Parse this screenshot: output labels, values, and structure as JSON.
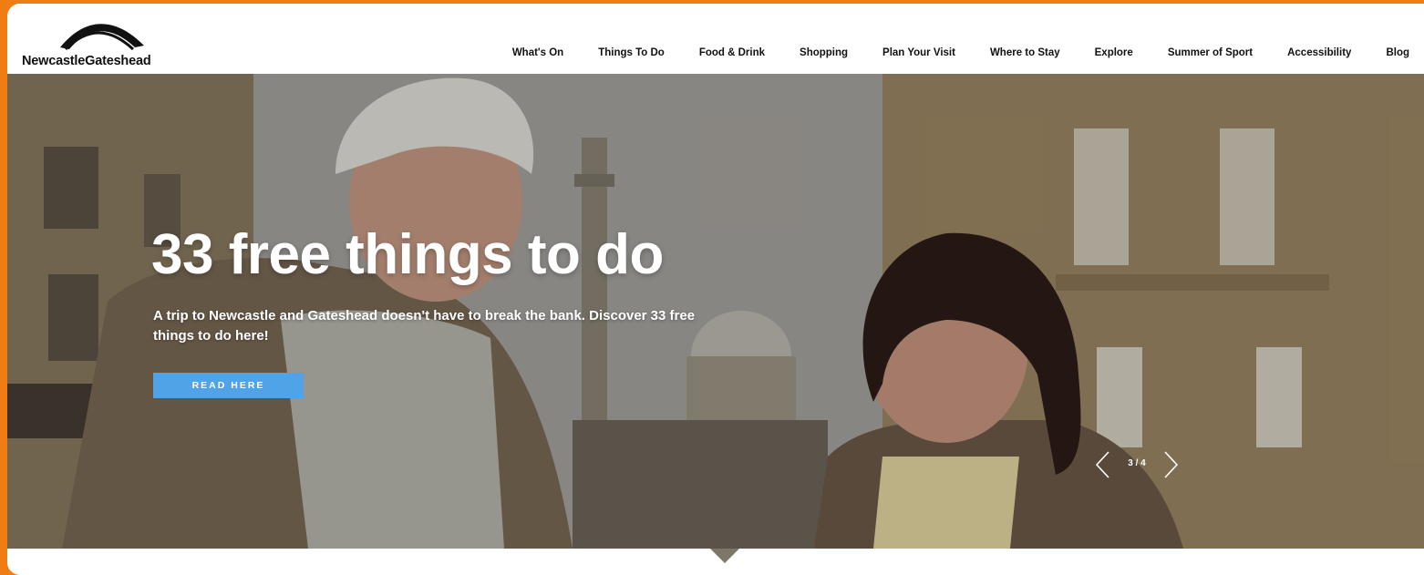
{
  "brand": {
    "name": "NewcastleGateshead"
  },
  "nav": [
    "What's On",
    "Things To Do",
    "Food & Drink",
    "Shopping",
    "Plan Your Visit",
    "Where to Stay",
    "Explore",
    "Summer of Sport",
    "Accessibility",
    "Blog"
  ],
  "hero": {
    "title": "33 free things to do",
    "description": "A trip to Newcastle and Gateshead doesn't have to break the bank. Discover 33 free things to do here!",
    "cta": "READ HERE",
    "slide_counter": "3 / 4"
  },
  "colors": {
    "frame": "#ef7d14",
    "cta": "#4fa3e6",
    "text": "#111111"
  },
  "icons": [
    "logo-arch-icon",
    "chevron-left-icon",
    "chevron-right-icon",
    "slide-pointer-icon"
  ]
}
